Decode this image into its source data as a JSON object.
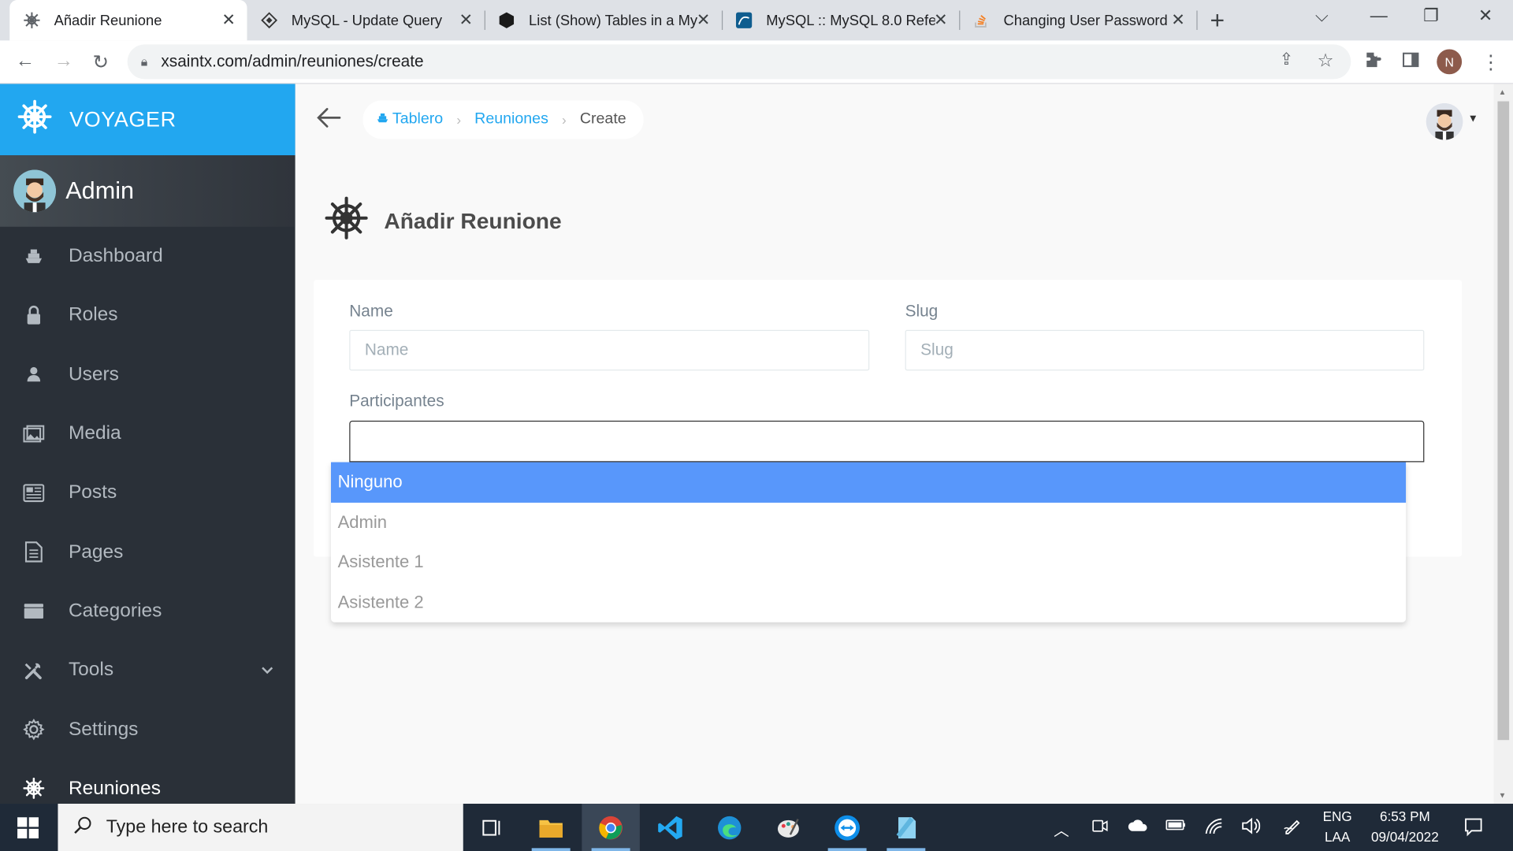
{
  "browser": {
    "tabs": [
      {
        "title": "Añadir Reunione",
        "icon": "helm-icon",
        "active": true
      },
      {
        "title": "MySQL - Update Query",
        "icon": "diamond-icon",
        "active": false
      },
      {
        "title": "List (Show) Tables in a My",
        "icon": "hexagon-icon",
        "active": false
      },
      {
        "title": "MySQL :: MySQL 8.0 Refer",
        "icon": "mysql-icon",
        "active": false
      },
      {
        "title": "Changing User Password",
        "icon": "stackoverflow-icon",
        "active": false
      }
    ],
    "url": "xsaintx.com/admin/reuniones/create",
    "profile_initial": "N"
  },
  "sidebar": {
    "brand": "VOYAGER",
    "user_name": "Admin",
    "items": [
      {
        "label": "Dashboard",
        "icon": "boat-icon"
      },
      {
        "label": "Roles",
        "icon": "lock-icon"
      },
      {
        "label": "Users",
        "icon": "person-icon"
      },
      {
        "label": "Media",
        "icon": "images-icon"
      },
      {
        "label": "Posts",
        "icon": "news-icon"
      },
      {
        "label": "Pages",
        "icon": "file-icon"
      },
      {
        "label": "Categories",
        "icon": "folder-icon"
      },
      {
        "label": "Tools",
        "icon": "tools-icon"
      },
      {
        "label": "Settings",
        "icon": "gear-icon"
      },
      {
        "label": "Reuniones",
        "icon": "helm-icon"
      }
    ]
  },
  "breadcrumb": {
    "home": "Tablero",
    "section": "Reuniones",
    "current": "Create"
  },
  "page": {
    "title": "Añadir Reunione"
  },
  "form": {
    "name_label": "Name",
    "name_placeholder": "Name",
    "slug_label": "Slug",
    "slug_placeholder": "Slug",
    "participants_label": "Participantes",
    "participants_value": "",
    "options": [
      "Ninguno",
      "Admin",
      "Asistente 1",
      "Asistente 2"
    ],
    "highlighted_option": "Ninguno"
  },
  "taskbar": {
    "search_placeholder": "Type here to search",
    "lang_top": "ENG",
    "lang_bottom": "LAA",
    "time": "6:53 PM",
    "date": "09/04/2022"
  },
  "colors": {
    "accent": "#22a7f0",
    "sidebar_bg": "#2a3038",
    "highlight": "#5897fb"
  }
}
